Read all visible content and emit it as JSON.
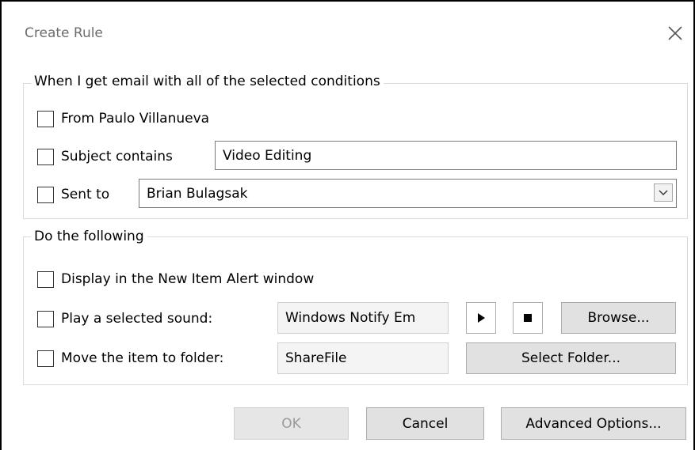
{
  "window": {
    "title": "Create Rule",
    "close_icon": "close-icon"
  },
  "conditions": {
    "legend": "When I get email with all of the selected conditions",
    "from": {
      "label": "From Paulo Villanueva",
      "checked": false
    },
    "subject": {
      "label": "Subject contains",
      "checked": false,
      "value": "Video Editing"
    },
    "sent_to": {
      "label": "Sent to",
      "checked": false,
      "value": "Brian Bulagsak",
      "icon": "chevron-down-icon"
    }
  },
  "actions": {
    "legend": "Do the following",
    "display_alert": {
      "label": "Display in the New Item Alert window",
      "checked": false
    },
    "play_sound": {
      "label": "Play a selected sound:",
      "checked": false,
      "value": "Windows Notify Em",
      "play_icon": "play-icon",
      "stop_icon": "stop-icon",
      "browse_label": "Browse..."
    },
    "move_folder": {
      "label": "Move the item to folder:",
      "checked": false,
      "value": "ShareFile",
      "select_label": "Select Folder..."
    }
  },
  "footer": {
    "ok_label": "OK",
    "cancel_label": "Cancel",
    "advanced_label": "Advanced Options..."
  }
}
